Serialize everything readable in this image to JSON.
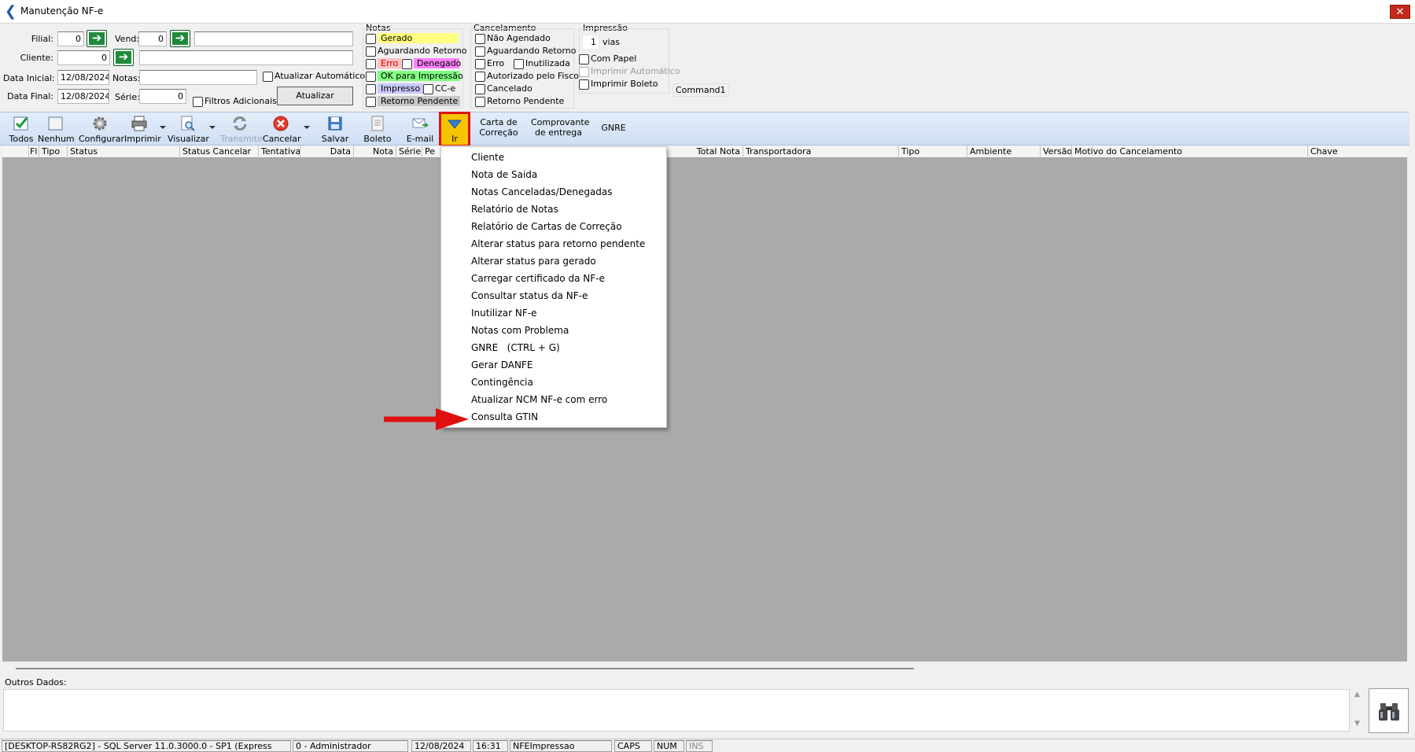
{
  "window": {
    "title": "Manutenção NF-e",
    "close": "✕"
  },
  "filters": {
    "filial_label": "Filial:",
    "filial_value": "0",
    "vend_label": "Vend:",
    "vend_value": "0",
    "cliente_label": "Cliente:",
    "cliente_value": "0",
    "data_inicial_label": "Data Inicial:",
    "data_inicial_value": "12/08/2024",
    "notas_label": "Notas:",
    "data_final_label": "Data Final:",
    "data_final_value": "12/08/2024",
    "serie_label": "Série:",
    "serie_value": "0",
    "atualizar_auto": "Atualizar Automático",
    "filtros_adicionais": "Filtros Adicionais",
    "atualizar_button": "Atualizar",
    "go_arrow": "➔"
  },
  "notas_group": {
    "title": "Notas",
    "items": [
      "Gerado",
      "Aguardando Retorno",
      "Erro",
      "Denegado",
      "OK para Impressão",
      "Impresso",
      "CC-e",
      "Retorno Pendente"
    ],
    "colors": {
      "gerado": "#ffff80",
      "erro": "#ffc0c0",
      "denegado": "#ff80ff",
      "ok": "#80ff80",
      "impresso": "#c8c8ff",
      "retorno": "#c8c8c8"
    }
  },
  "cancelamento_group": {
    "title": "Cancelamento",
    "items": [
      "Não Agendado",
      "Aguardando Retorno",
      "Erro",
      "Inutilizada",
      "Autorizado pelo Fisco",
      "Cancelado",
      "Retorno Pendente"
    ]
  },
  "impressao_group": {
    "title": "Impressão",
    "vias_value": "1",
    "vias_label": "vias",
    "com_papel": "Com Papel",
    "imprimir_automatico": "Imprimir Automático",
    "imprimir_boleto": "Imprimir Boleto",
    "command1": "Command1"
  },
  "toolbar": {
    "todos": "Todos",
    "nenhum": "Nenhum",
    "configurar": "Configurar",
    "imprimir": "Imprimir",
    "visualizar": "Visualizar",
    "transmitir": "Transmitir",
    "cancelar": "Cancelar",
    "salvar": "Salvar",
    "boleto": "Boleto",
    "email": "E-mail",
    "ir": "Ir",
    "carta_1": "Carta de",
    "carta_2": "Correção",
    "comprovante_1": "Comprovante",
    "comprovante_2": "de entrega",
    "gnre": "GNRE"
  },
  "grid": {
    "columns": [
      "Fl",
      "Tipo",
      "Status",
      "Status Cancelar",
      "Tentativa",
      "Data",
      "Nota",
      "Série",
      "Pe",
      "Total Nota",
      "Transportadora",
      "Tipo",
      "Ambiente",
      "Versão",
      "Motivo do Cancelamento",
      "Chave"
    ]
  },
  "menu": {
    "items": [
      "Cliente",
      "Nota de Saida",
      "Notas Canceladas/Denegadas",
      "Relatório de Notas",
      "Relatório de Cartas de Correção",
      "Alterar status para retorno pendente",
      "Alterar status para gerado",
      "Carregar certificado da NF-e",
      "Consultar status da NF-e",
      "Inutilizar NF-e",
      "Notas com Problema",
      "GNRE   (CTRL + G)",
      "Gerar DANFE",
      "Contingência",
      "Atualizar NCM NF-e com erro",
      "Consulta GTIN"
    ]
  },
  "outros_dados": {
    "label": "Outros Dados:"
  },
  "statusbar": [
    "[DESKTOP-RS82RG2] - SQL Server 11.0.3000.0 - SP1 (Express",
    "0 - Administrador",
    "12/08/2024",
    "16:31",
    "NFEImpressao",
    "CAPS",
    "NUM",
    "INS"
  ]
}
